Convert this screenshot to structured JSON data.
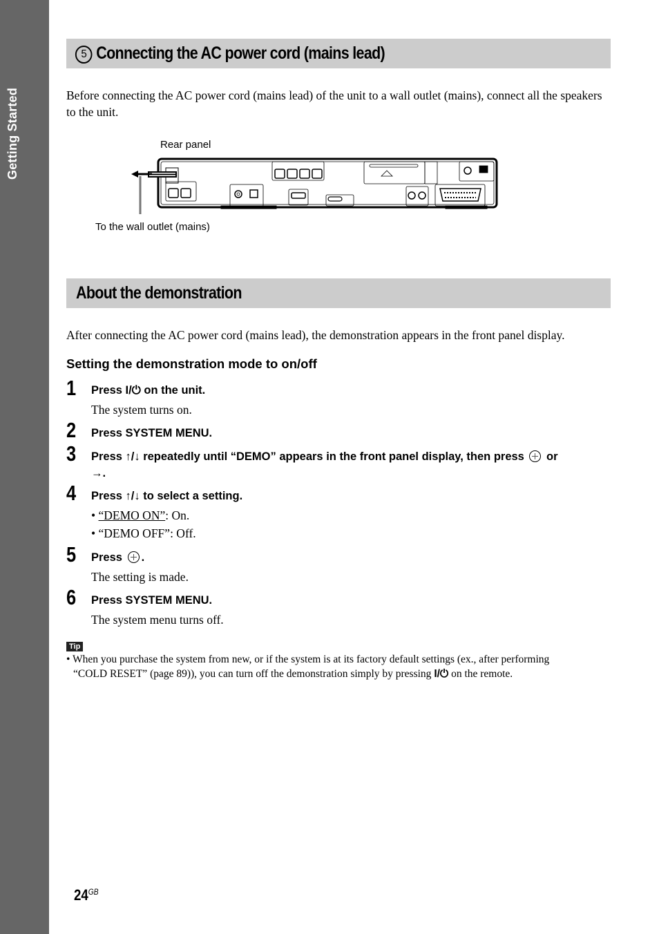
{
  "sidebar": {
    "section_label": "Getting Started",
    "color": "#666666"
  },
  "section1": {
    "number_glyph": "5",
    "title": "Connecting the AC power cord (mains lead)",
    "intro": "Before connecting the AC power cord (mains lead) of the unit to a wall outlet (mains), connect all the speakers to the unit.",
    "diagram": {
      "label_top": "Rear panel",
      "label_bottom": "To the wall outlet (mains)"
    }
  },
  "section2": {
    "title": "About the demonstration",
    "intro": "After connecting the AC power cord (mains lead), the demonstration appears in the front panel display.",
    "subheading": "Setting the demonstration mode to on/off",
    "steps": [
      {
        "num": "1",
        "pre": "Press ",
        "symbol": "I/⏻",
        "post": " on the unit.",
        "desc": "The system turns on."
      },
      {
        "num": "2",
        "text": "Press SYSTEM MENU."
      },
      {
        "num": "3",
        "pre": "Press ↑/↓ repeatedly until “DEMO” appears in the front panel display, then press",
        "post": " or",
        "line2": "→."
      },
      {
        "num": "4",
        "text": "Press ↑/↓ to select a setting.",
        "options": [
          {
            "value": "“DEMO ON”",
            "desc": ": On.",
            "default": true
          },
          {
            "value": "“DEMO OFF”",
            "desc": ": Off."
          }
        ]
      },
      {
        "num": "5",
        "pre": "Press",
        "post": ".",
        "desc": "The setting is made."
      },
      {
        "num": "6",
        "text": "Press SYSTEM MENU.",
        "desc": "The system menu turns off."
      }
    ]
  },
  "tip": {
    "badge": "Tip",
    "line1": "• When you purchase the system from new, or if the system is at its factory default settings (ex., after performing",
    "line2_pre": "“COLD RESET” (page 89)), you can turn off the demonstration simply by pressing ",
    "line2_symbol": "I/⏻",
    "line2_post": " on the remote."
  },
  "footer": {
    "page": "24",
    "suffix": "GB"
  }
}
